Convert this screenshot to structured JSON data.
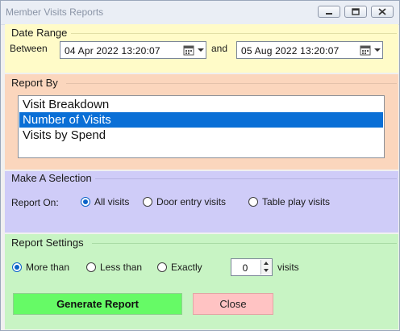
{
  "window": {
    "title": "Member Visits Reports"
  },
  "date_range": {
    "heading": "Date Range",
    "between_label": "Between",
    "start": "04 Apr 2022   13:20:07",
    "and_label": "and",
    "end": "05 Aug 2022   13:20:07"
  },
  "report_by": {
    "heading": "Report By",
    "items": [
      {
        "label": "Visit Breakdown",
        "selected": false
      },
      {
        "label": "Number of Visits",
        "selected": true
      },
      {
        "label": "Visits by Spend",
        "selected": false
      }
    ]
  },
  "selection": {
    "heading": "Make A Selection",
    "report_on_label": "Report On:",
    "options": [
      {
        "label": "All visits",
        "checked": true
      },
      {
        "label": "Door entry visits",
        "checked": false
      },
      {
        "label": "Table play visits",
        "checked": false
      }
    ]
  },
  "settings": {
    "heading": "Report Settings",
    "options": [
      {
        "label": "More than",
        "checked": true
      },
      {
        "label": "Less than",
        "checked": false
      },
      {
        "label": "Exactly",
        "checked": false
      }
    ],
    "count": "0",
    "unit_label": "visits",
    "generate_label": "Generate Report",
    "close_label": "Close"
  },
  "colors": {
    "date_range_bg": "#fffbc8",
    "report_by_bg": "#fbd6bd",
    "selection_bg": "#cfccf8",
    "settings_bg": "#c8f4c4",
    "list_selection": "#0a6fd6",
    "generate_button": "#66fa66",
    "close_button": "#ffc3c3"
  }
}
